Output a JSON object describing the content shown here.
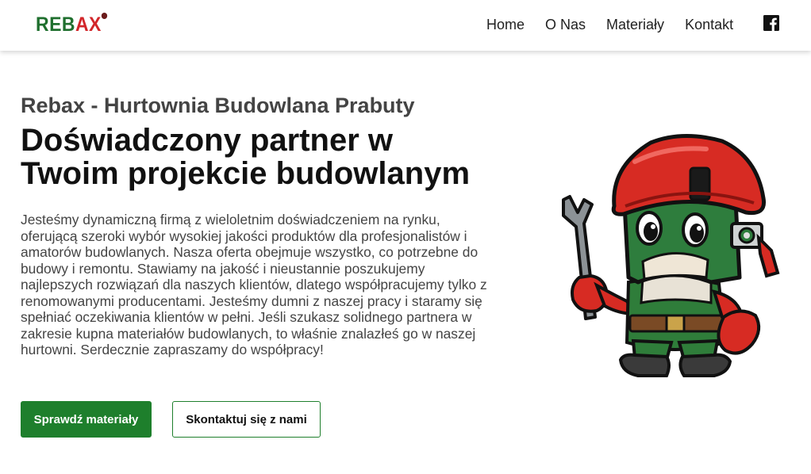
{
  "brand": {
    "logo_part1": "REB",
    "logo_part2": "AX"
  },
  "nav": {
    "items": [
      "Home",
      "O Nas",
      "Materiały",
      "Kontakt"
    ],
    "social_icon": "facebook-icon"
  },
  "hero": {
    "subtitle": "Rebax - Hurtownia Budowlana Prabuty",
    "title": "Doświadczony partner w Twoim projekcie budowlanym",
    "description": "Jesteśmy dynamiczną firmą z wieloletnim doświadczeniem na rynku, oferującą szeroki wybór wysokiej jakości produktów dla profesjonalistów i amatorów budowlanych. Nasza oferta obejmuje wszystko, co potrzebne do budowy i remontu. Stawiamy na jakość i nieustannie poszukujemy najlepszych rozwiązań dla naszych klientów, dlatego współpracujemy tylko z renomowanymi producentami. Jesteśmy dumni z naszej pracy i staramy się spełniać oczekiwania klientów w pełni. Jeśli szukasz solidnego partnera w zakresie kupna materiałów budowlanych, to właśnie znalazłeś go w naszej hurtowni. Serdecznie zapraszamy do współpracy!",
    "primary_button": "Sprawdź materiały",
    "secondary_button": "Skontaktuj się z nami"
  },
  "colors": {
    "brand_green": "#1e7f2c",
    "brand_red": "#d2262a"
  }
}
